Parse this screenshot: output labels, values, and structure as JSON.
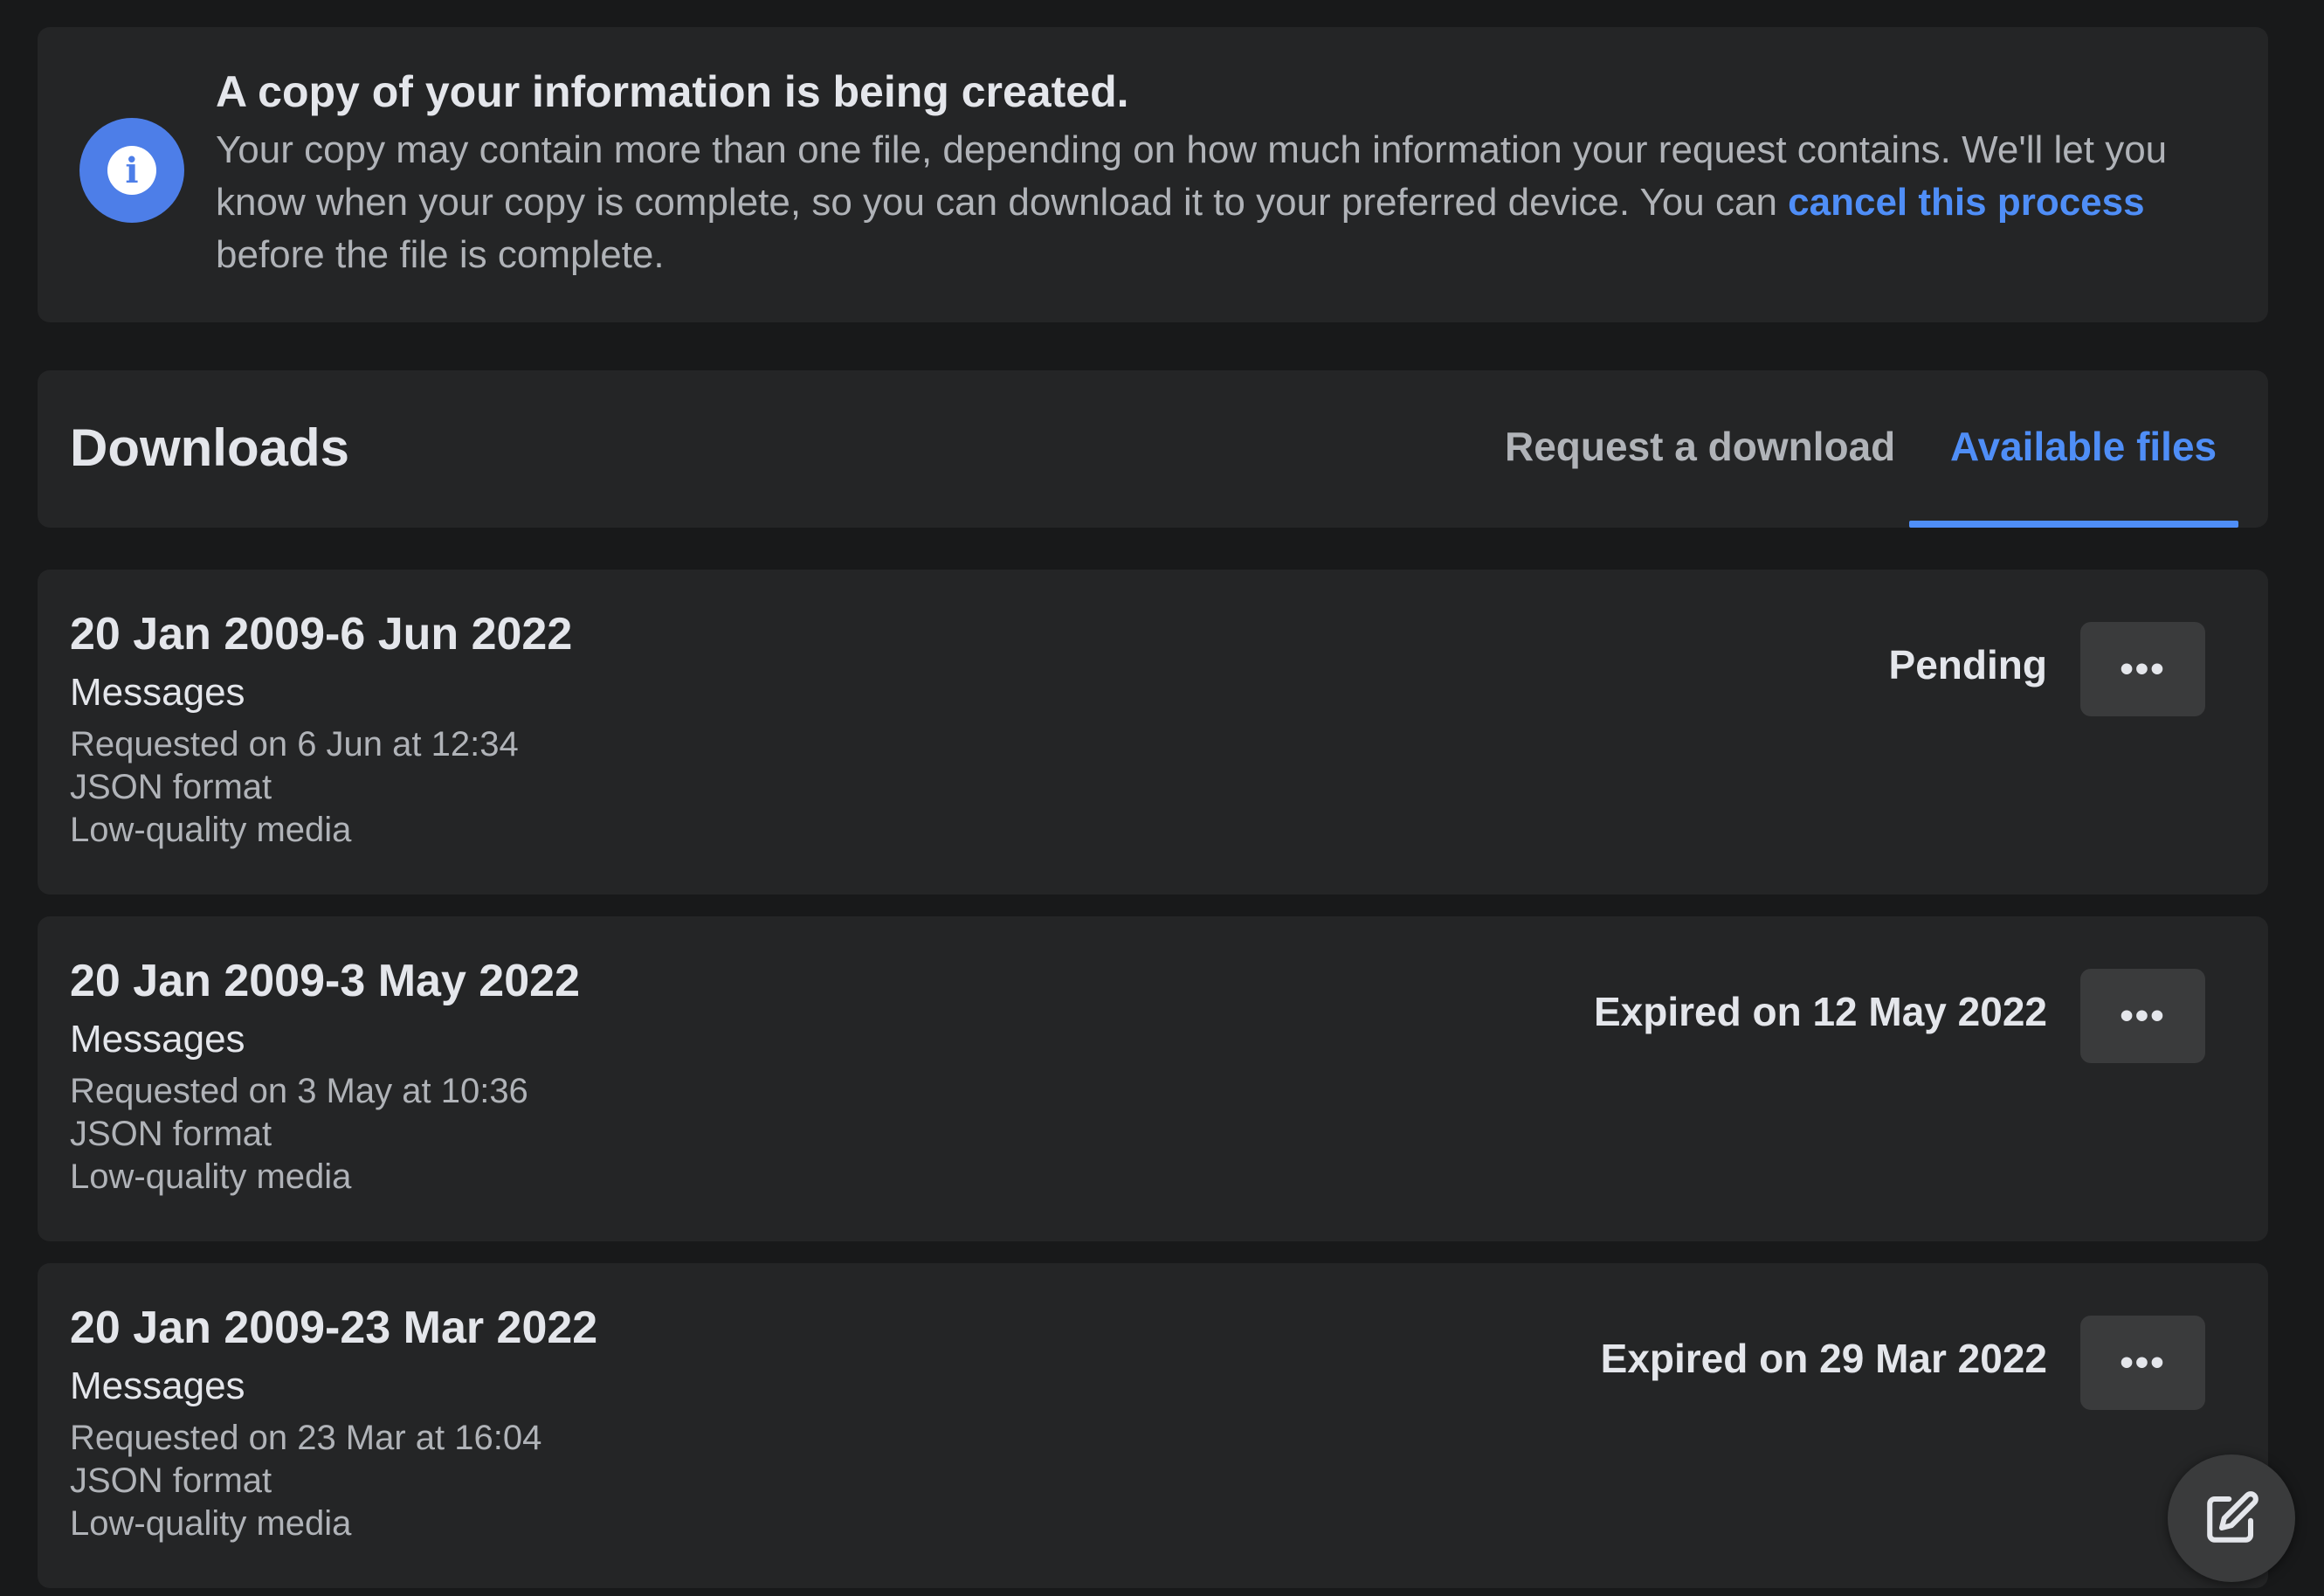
{
  "banner": {
    "icon": "info-icon",
    "title": "A copy of your information is being created.",
    "body_line1": "Your copy may contain more than one file, depending on how much information your request contains. We'll let you know when your copy is complete, so you can download it to your preferred device. You can ",
    "cancel_link": "cancel this process",
    "body_line2": " before the file is complete."
  },
  "downloads": {
    "title": "Downloads",
    "tabs": [
      {
        "label": "Request a download",
        "active": false
      },
      {
        "label": "Available files",
        "active": true
      }
    ]
  },
  "files": [
    {
      "title": "20 Jan 2009-6 Jun 2022",
      "type": "Messages",
      "requested": "Requested on 6 Jun at 12:34",
      "format": "JSON format",
      "quality": "Low-quality media",
      "status": "Pending",
      "more_label": "•••"
    },
    {
      "title": "20 Jan 2009-3 May 2022",
      "type": "Messages",
      "requested": "Requested on 3 May at 10:36",
      "format": "JSON format",
      "quality": "Low-quality media",
      "status": "Expired on 12 May 2022",
      "more_label": "•••"
    },
    {
      "title": "20 Jan 2009-23 Mar 2022",
      "type": "Messages",
      "requested": "Requested on 23 Mar at 16:04",
      "format": "JSON format",
      "quality": "Low-quality media",
      "status": "Expired on 29 Mar 2022",
      "more_label": "•••"
    }
  ],
  "fab": {
    "icon": "compose-icon"
  },
  "colors": {
    "background": "#18191a",
    "card": "#242526",
    "accent": "#4f8ef7",
    "info_icon": "#4d7ee8",
    "button": "#3a3b3c"
  }
}
